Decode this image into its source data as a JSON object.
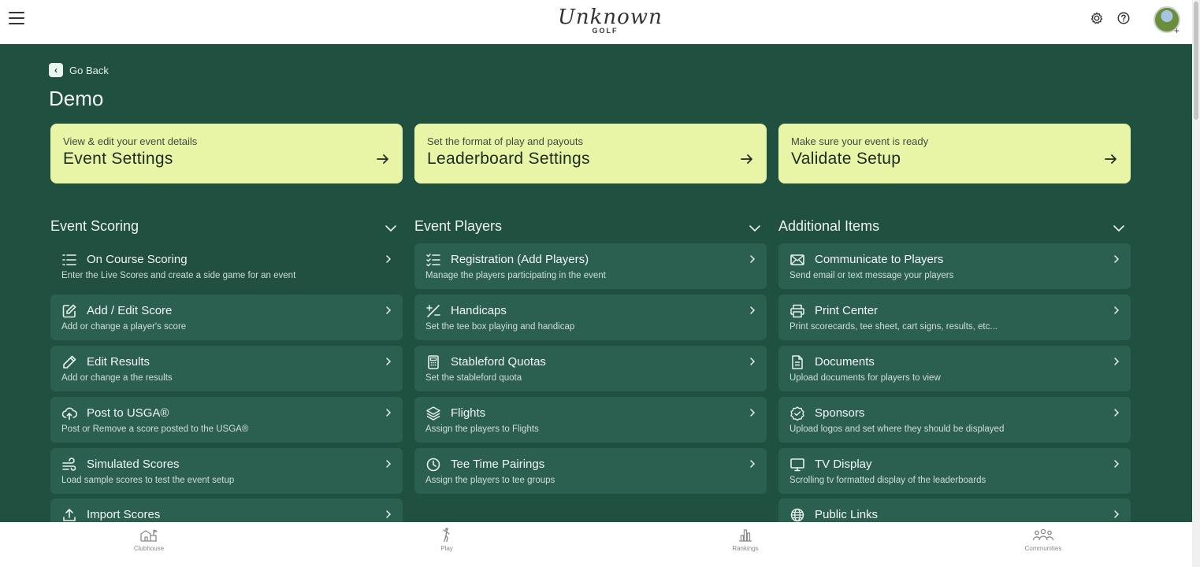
{
  "header": {
    "logo_script": "Unknown",
    "logo_sub": "GOLF"
  },
  "nav": {
    "go_back": "Go Back",
    "page_title": "Demo"
  },
  "top_cards": [
    {
      "subtitle": "View & edit your event details",
      "title": "Event Settings"
    },
    {
      "subtitle": "Set the format of play and payouts",
      "title": "Leaderboard Settings"
    },
    {
      "subtitle": "Make sure your event is ready",
      "title": "Validate Setup"
    }
  ],
  "sections": [
    {
      "title": "Event Scoring",
      "items": [
        {
          "icon": "list-numbered-icon",
          "title": "On Course Scoring",
          "desc": "Enter the Live Scores and create a side game for an event"
        },
        {
          "icon": "edit-square-icon",
          "title": "Add / Edit Score",
          "desc": "Add or change a player's score"
        },
        {
          "icon": "pencil-icon",
          "title": "Edit Results",
          "desc": "Add or change a the results"
        },
        {
          "icon": "cloud-upload-icon",
          "title": "Post to USGA®",
          "desc": "Post or Remove a score posted to the USGA®"
        },
        {
          "icon": "wind-icon",
          "title": "Simulated Scores",
          "desc": "Load sample scores to test the event setup"
        },
        {
          "icon": "upload-icon",
          "title": "Import Scores",
          "desc": ""
        }
      ]
    },
    {
      "title": "Event Players",
      "items": [
        {
          "icon": "checklist-icon",
          "title": "Registration (Add Players)",
          "desc": "Manage the players participating in the event"
        },
        {
          "icon": "plus-minus-icon",
          "title": "Handicaps",
          "desc": "Set the tee box playing and handicap"
        },
        {
          "icon": "calculator-icon",
          "title": "Stableford Quotas",
          "desc": "Set the stableford quota"
        },
        {
          "icon": "layers-icon",
          "title": "Flights",
          "desc": "Assign the players to Flights"
        },
        {
          "icon": "clock-icon",
          "title": "Tee Time Pairings",
          "desc": "Assign the players to tee groups"
        }
      ]
    },
    {
      "title": "Additional Items",
      "items": [
        {
          "icon": "envelope-icon",
          "title": "Communicate to Players",
          "desc": "Send email or text message your players"
        },
        {
          "icon": "printer-icon",
          "title": "Print Center",
          "desc": "Print scorecards, tee sheet, cart signs, results, etc..."
        },
        {
          "icon": "document-icon",
          "title": "Documents",
          "desc": "Upload documents for players to view"
        },
        {
          "icon": "badge-check-icon",
          "title": "Sponsors",
          "desc": "Upload logos and set where they should be displayed"
        },
        {
          "icon": "monitor-icon",
          "title": "TV Display",
          "desc": "Scrolling tv formatted display of the leaderboards"
        },
        {
          "icon": "globe-icon",
          "title": "Public Links",
          "desc": ""
        }
      ]
    }
  ],
  "bottom_nav": [
    {
      "icon": "clubhouse-icon",
      "label": "Clubhouse"
    },
    {
      "icon": "golfer-icon",
      "label": "Play"
    },
    {
      "icon": "bar-chart-icon",
      "label": "Rankings"
    },
    {
      "icon": "people-icon",
      "label": "Communities"
    }
  ],
  "colors": {
    "main_bg": "#1f5040",
    "card_bg": "#e8f5a6",
    "item_bg": "#2b6050"
  }
}
